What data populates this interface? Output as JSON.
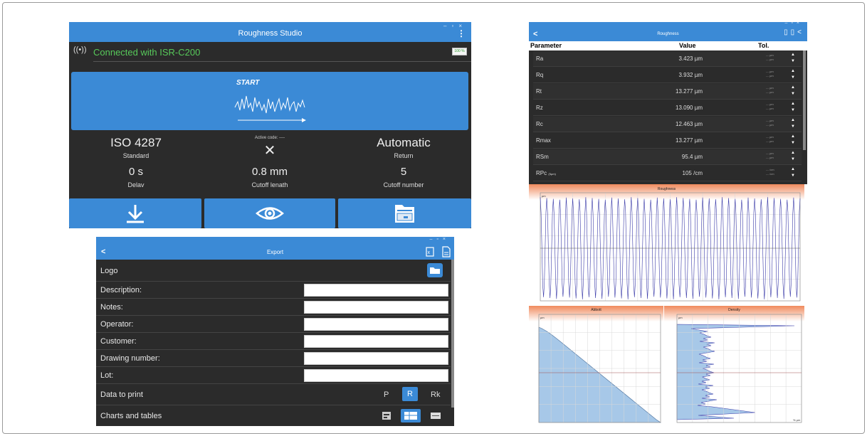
{
  "studio": {
    "title": "Roughness Studio",
    "menu_icon": "kebab-icon",
    "connection": "Connected with ISR-C200",
    "battery": "100 %",
    "start": "START",
    "standard_value": "ISO 4287",
    "standard_label": "Standard",
    "active_code": "Active code: ----",
    "return_value": "Automatic",
    "return_label": "Return",
    "delay_value": "0 s",
    "delay_label": "Delav",
    "cutoff_length_value": "0.8 mm",
    "cutoff_length_label": "Cutoff lenath",
    "cutoff_number_value": "5",
    "cutoff_number_label": "Cutoff number",
    "accent": "#3b8ad6",
    "connected_color": "#57c95a"
  },
  "export": {
    "back": "<",
    "title": "Export",
    "logo_label": "Logo",
    "fields": [
      {
        "label": "Description:"
      },
      {
        "label": "Notes:"
      },
      {
        "label": "Operator:"
      },
      {
        "label": "Customer:"
      },
      {
        "label": "Drawing number:"
      },
      {
        "label": "Lot:"
      }
    ],
    "data_to_print_label": "Data to print",
    "print_options": [
      "P",
      "R",
      "Rk"
    ],
    "print_selected": "R",
    "charts_tables_label": "Charts and tables"
  },
  "roughness": {
    "back": "<",
    "title": "Roughness",
    "columns": [
      "Parameter",
      "Value",
      "Tol."
    ],
    "rows": [
      {
        "name": "Ra",
        "sub": "",
        "value": "3.423 µm",
        "unit": "µm"
      },
      {
        "name": "Rq",
        "sub": "",
        "value": "3.932 µm",
        "unit": "µm"
      },
      {
        "name": "Rt",
        "sub": "",
        "value": "13.277 µm",
        "unit": "µm"
      },
      {
        "name": "Rz",
        "sub": "",
        "value": "13.090 µm",
        "unit": "µm"
      },
      {
        "name": "Rc",
        "sub": "",
        "value": "12.463 µm",
        "unit": "µm"
      },
      {
        "name": "Rmax",
        "sub": "",
        "value": "13.277 µm",
        "unit": "µm"
      },
      {
        "name": "RSm",
        "sub": "",
        "value": "95.4 µm",
        "unit": "µm"
      },
      {
        "name": "RPc",
        "sub": "(5µm)",
        "value": "105 /cm",
        "unit": "/cm"
      }
    ],
    "tol_placeholder": "---"
  },
  "charts": {
    "roughness_title": "Roughness",
    "abbott_title": "Abbott",
    "density_title": "Density",
    "unit_label": "µm",
    "density_corner": "% µm",
    "header_gradient_top": "#f08a5d",
    "header_gradient_bottom": "#ffffff",
    "trace_color": "#3a3aa8",
    "fill_color": "#a7c8e8"
  }
}
